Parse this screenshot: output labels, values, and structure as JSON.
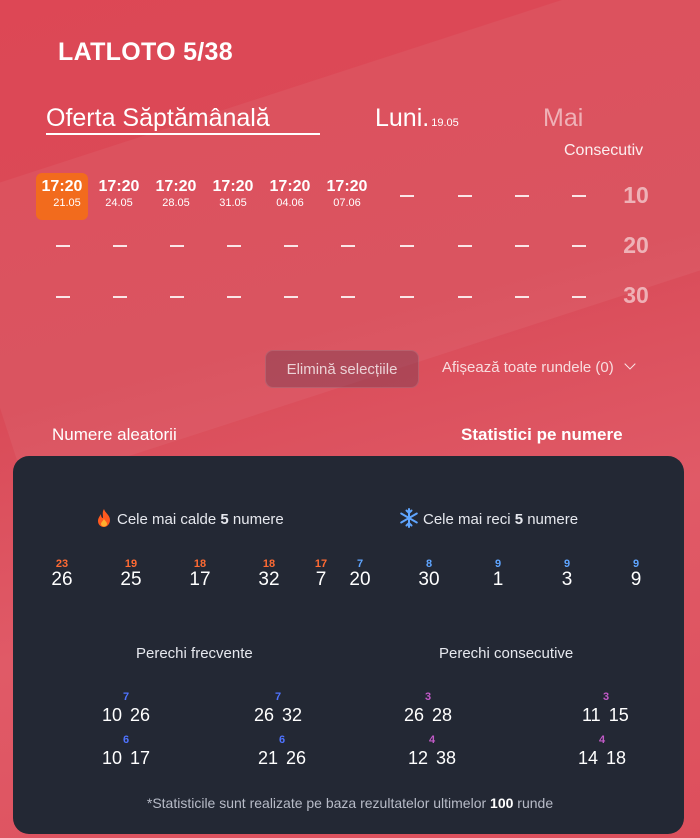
{
  "header": {
    "title": "LATLOTO 5/38"
  },
  "tabs": [
    {
      "label": "Oferta Săptămânală",
      "sub": "",
      "active": true
    },
    {
      "label": "Luni.",
      "sub": "19.05",
      "active": false
    },
    {
      "label": "Mai",
      "sub": "",
      "active": false
    }
  ],
  "consecutive_label": "Consecutiv",
  "draws": [
    {
      "time": "17:20",
      "date": "21.05",
      "selected": true
    },
    {
      "time": "17:20",
      "date": "24.05",
      "selected": false
    },
    {
      "time": "17:20",
      "date": "28.05",
      "selected": false
    },
    {
      "time": "17:20",
      "date": "31.05",
      "selected": false
    },
    {
      "time": "17:20",
      "date": "04.06",
      "selected": false
    },
    {
      "time": "17:20",
      "date": "07.06",
      "selected": false
    }
  ],
  "consecutive_options": [
    "10",
    "20",
    "30"
  ],
  "buttons": {
    "clear": "Elimină selecțiile",
    "show_all": "Afișează toate rundele (0)"
  },
  "bottom_tabs": {
    "random": "Numere aleatorii",
    "stats": "Statistici pe numere"
  },
  "stats": {
    "hot_heading": {
      "pre": "Cele mai calde",
      "count": "5",
      "post": "numere"
    },
    "cold_heading": {
      "pre": "Cele mai reci",
      "count": "5",
      "post": "numere"
    },
    "hot_numbers": [
      {
        "number": "26",
        "count": "23"
      },
      {
        "number": "25",
        "count": "19"
      },
      {
        "number": "17",
        "count": "18"
      },
      {
        "number": "32",
        "count": "18"
      },
      {
        "number": "7",
        "count": "17"
      }
    ],
    "cold_numbers": [
      {
        "number": "20",
        "count": "7"
      },
      {
        "number": "30",
        "count": "8"
      },
      {
        "number": "1",
        "count": "9"
      },
      {
        "number": "3",
        "count": "9"
      },
      {
        "number": "9",
        "count": "9"
      }
    ],
    "frequent_pairs_heading": "Perechi frecvente",
    "consecutive_pairs_heading": "Perechi consecutive",
    "frequent_pairs": [
      {
        "a": "10",
        "b": "26",
        "count": "7"
      },
      {
        "a": "26",
        "b": "32",
        "count": "7"
      },
      {
        "a": "10",
        "b": "17",
        "count": "6"
      },
      {
        "a": "21",
        "b": "26",
        "count": "6"
      }
    ],
    "consecutive_pairs": [
      {
        "a": "26",
        "b": "28",
        "count": "3"
      },
      {
        "a": "11",
        "b": "15",
        "count": "3"
      },
      {
        "a": "12",
        "b": "38",
        "count": "4"
      },
      {
        "a": "14",
        "b": "18",
        "count": "4"
      }
    ],
    "footnote": {
      "pre": "*Statisticile sunt realizate pe baza rezultatelor ultimelor",
      "count": "100",
      "post": "runde"
    }
  },
  "colors": {
    "background": "#d94a57",
    "selected": "#f26b1d",
    "panel": "#232834",
    "hot": "#ff6a33",
    "cold": "#5fa5ff"
  },
  "icons": {
    "hot": "fire-icon",
    "cold": "snowflake-icon",
    "dropdown": "chevron-down-icon"
  }
}
